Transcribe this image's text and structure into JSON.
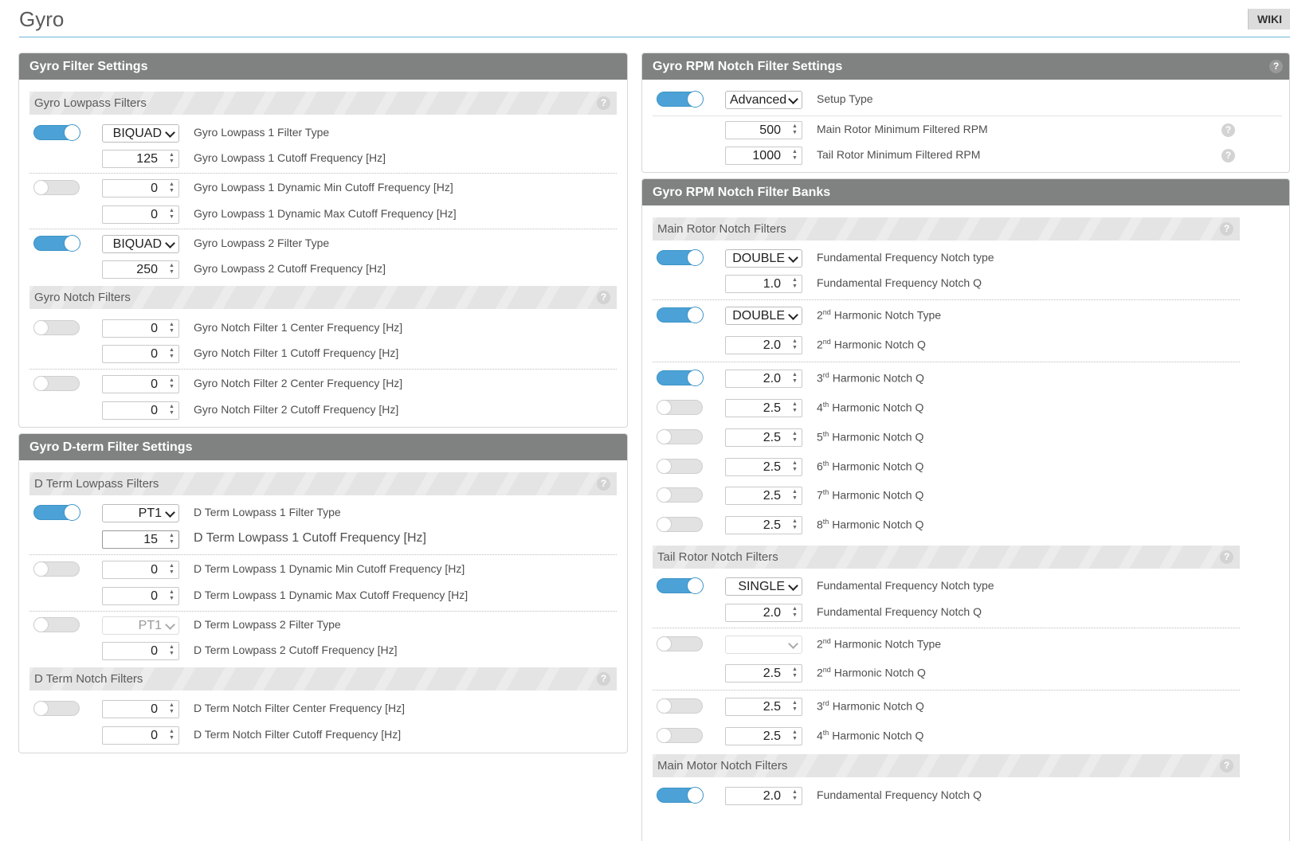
{
  "page": {
    "title": "Gyro",
    "wiki": "WIKI"
  },
  "filter_settings": {
    "title": "Gyro Filter Settings",
    "lowpass_header": "Gyro Lowpass Filters",
    "lp1_type": {
      "value": "BIQUAD",
      "label": "Gyro Lowpass 1 Filter Type"
    },
    "lp1_cutoff": {
      "value": "125",
      "label": "Gyro Lowpass 1 Cutoff Frequency [Hz]"
    },
    "lp1_dyn_min": {
      "value": "0",
      "label": "Gyro Lowpass 1 Dynamic Min Cutoff Frequency [Hz]"
    },
    "lp1_dyn_max": {
      "value": "0",
      "label": "Gyro Lowpass 1 Dynamic Max Cutoff Frequency [Hz]"
    },
    "lp2_type": {
      "value": "BIQUAD",
      "label": "Gyro Lowpass 2 Filter Type"
    },
    "lp2_cutoff": {
      "value": "250",
      "label": "Gyro Lowpass 2 Cutoff Frequency [Hz]"
    },
    "notch_header": "Gyro Notch Filters",
    "n1_center": {
      "value": "0",
      "label": "Gyro Notch Filter 1 Center Frequency [Hz]"
    },
    "n1_cutoff": {
      "value": "0",
      "label": "Gyro Notch Filter 1 Cutoff Frequency [Hz]"
    },
    "n2_center": {
      "value": "0",
      "label": "Gyro Notch Filter 2 Center Frequency [Hz]"
    },
    "n2_cutoff": {
      "value": "0",
      "label": "Gyro Notch Filter 2 Cutoff Frequency [Hz]"
    }
  },
  "dterm": {
    "title": "Gyro D-term Filter Settings",
    "lowpass_header": "D Term Lowpass Filters",
    "lp1_type": {
      "value": "PT1",
      "label": "D Term Lowpass 1 Filter Type"
    },
    "lp1_cutoff": {
      "value": "15",
      "label": "D Term Lowpass 1 Cutoff Frequency [Hz]"
    },
    "lp1_dyn_min": {
      "value": "0",
      "label": "D Term Lowpass 1 Dynamic Min Cutoff Frequency [Hz]"
    },
    "lp1_dyn_max": {
      "value": "0",
      "label": "D Term Lowpass 1 Dynamic Max Cutoff Frequency [Hz]"
    },
    "lp2_type": {
      "value": "PT1",
      "label": "D Term Lowpass 2 Filter Type"
    },
    "lp2_cutoff": {
      "value": "0",
      "label": "D Term Lowpass 2 Cutoff Frequency [Hz]"
    },
    "notch_header": "D Term Notch Filters",
    "n_center": {
      "value": "0",
      "label": "D Term Notch Filter Center Frequency [Hz]"
    },
    "n_cutoff": {
      "value": "0",
      "label": "D Term Notch Filter Cutoff Frequency [Hz]"
    }
  },
  "rpm_settings": {
    "title": "Gyro RPM Notch Filter Settings",
    "setup_type": {
      "value": "Advanced",
      "label": "Setup Type"
    },
    "main_min_rpm": {
      "value": "500",
      "label": "Main Rotor Minimum Filtered RPM"
    },
    "tail_min_rpm": {
      "value": "1000",
      "label": "Tail Rotor Minimum Filtered RPM"
    }
  },
  "rpm_banks": {
    "title": "Gyro RPM Notch Filter Banks",
    "main_header": "Main Rotor Notch Filters",
    "main_fund_type": {
      "value": "DOUBLE",
      "label": "Fundamental Frequency Notch type"
    },
    "main_fund_q": {
      "value": "1.0",
      "label": "Fundamental Frequency Notch Q"
    },
    "main_h2_type": {
      "value": "DOUBLE",
      "label": "Harmonic Notch Type",
      "ord": "2",
      "sup": "nd"
    },
    "main_h2_q": {
      "value": "2.0",
      "label": "Harmonic Notch Q",
      "ord": "2",
      "sup": "nd"
    },
    "main_h3_q": {
      "value": "2.0",
      "label": "Harmonic Notch Q",
      "ord": "3",
      "sup": "rd"
    },
    "main_h4_q": {
      "value": "2.5",
      "label": "Harmonic Notch Q",
      "ord": "4",
      "sup": "th"
    },
    "main_h5_q": {
      "value": "2.5",
      "label": "Harmonic Notch Q",
      "ord": "5",
      "sup": "th"
    },
    "main_h6_q": {
      "value": "2.5",
      "label": "Harmonic Notch Q",
      "ord": "6",
      "sup": "th"
    },
    "main_h7_q": {
      "value": "2.5",
      "label": "Harmonic Notch Q",
      "ord": "7",
      "sup": "th"
    },
    "main_h8_q": {
      "value": "2.5",
      "label": "Harmonic Notch Q",
      "ord": "8",
      "sup": "th"
    },
    "tail_header": "Tail Rotor Notch Filters",
    "tail_fund_type": {
      "value": "SINGLE",
      "label": "Fundamental Frequency Notch type"
    },
    "tail_fund_q": {
      "value": "2.0",
      "label": "Fundamental Frequency Notch Q"
    },
    "tail_h2_type": {
      "value": "",
      "label": "Harmonic Notch Type",
      "ord": "2",
      "sup": "nd"
    },
    "tail_h2_q": {
      "value": "2.5",
      "label": "Harmonic Notch Q",
      "ord": "2",
      "sup": "nd"
    },
    "tail_h3_q": {
      "value": "2.5",
      "label": "Harmonic Notch Q",
      "ord": "3",
      "sup": "rd"
    },
    "tail_h4_q": {
      "value": "2.5",
      "label": "Harmonic Notch Q",
      "ord": "4",
      "sup": "th"
    },
    "motor_header": "Main Motor Notch Filters",
    "motor_fund_q": {
      "value": "2.0",
      "label": "Fundamental Frequency Notch Q"
    }
  },
  "icons": {
    "help": "help-icon",
    "toggle": "toggle-switch",
    "spinner": "spinner-arrows-icon",
    "dropdown": "chevron-down-icon"
  },
  "colors": {
    "header_bg": "#7f8280",
    "toggle_on": "#4ca2d6",
    "title_rule": "#6fb6d8"
  }
}
